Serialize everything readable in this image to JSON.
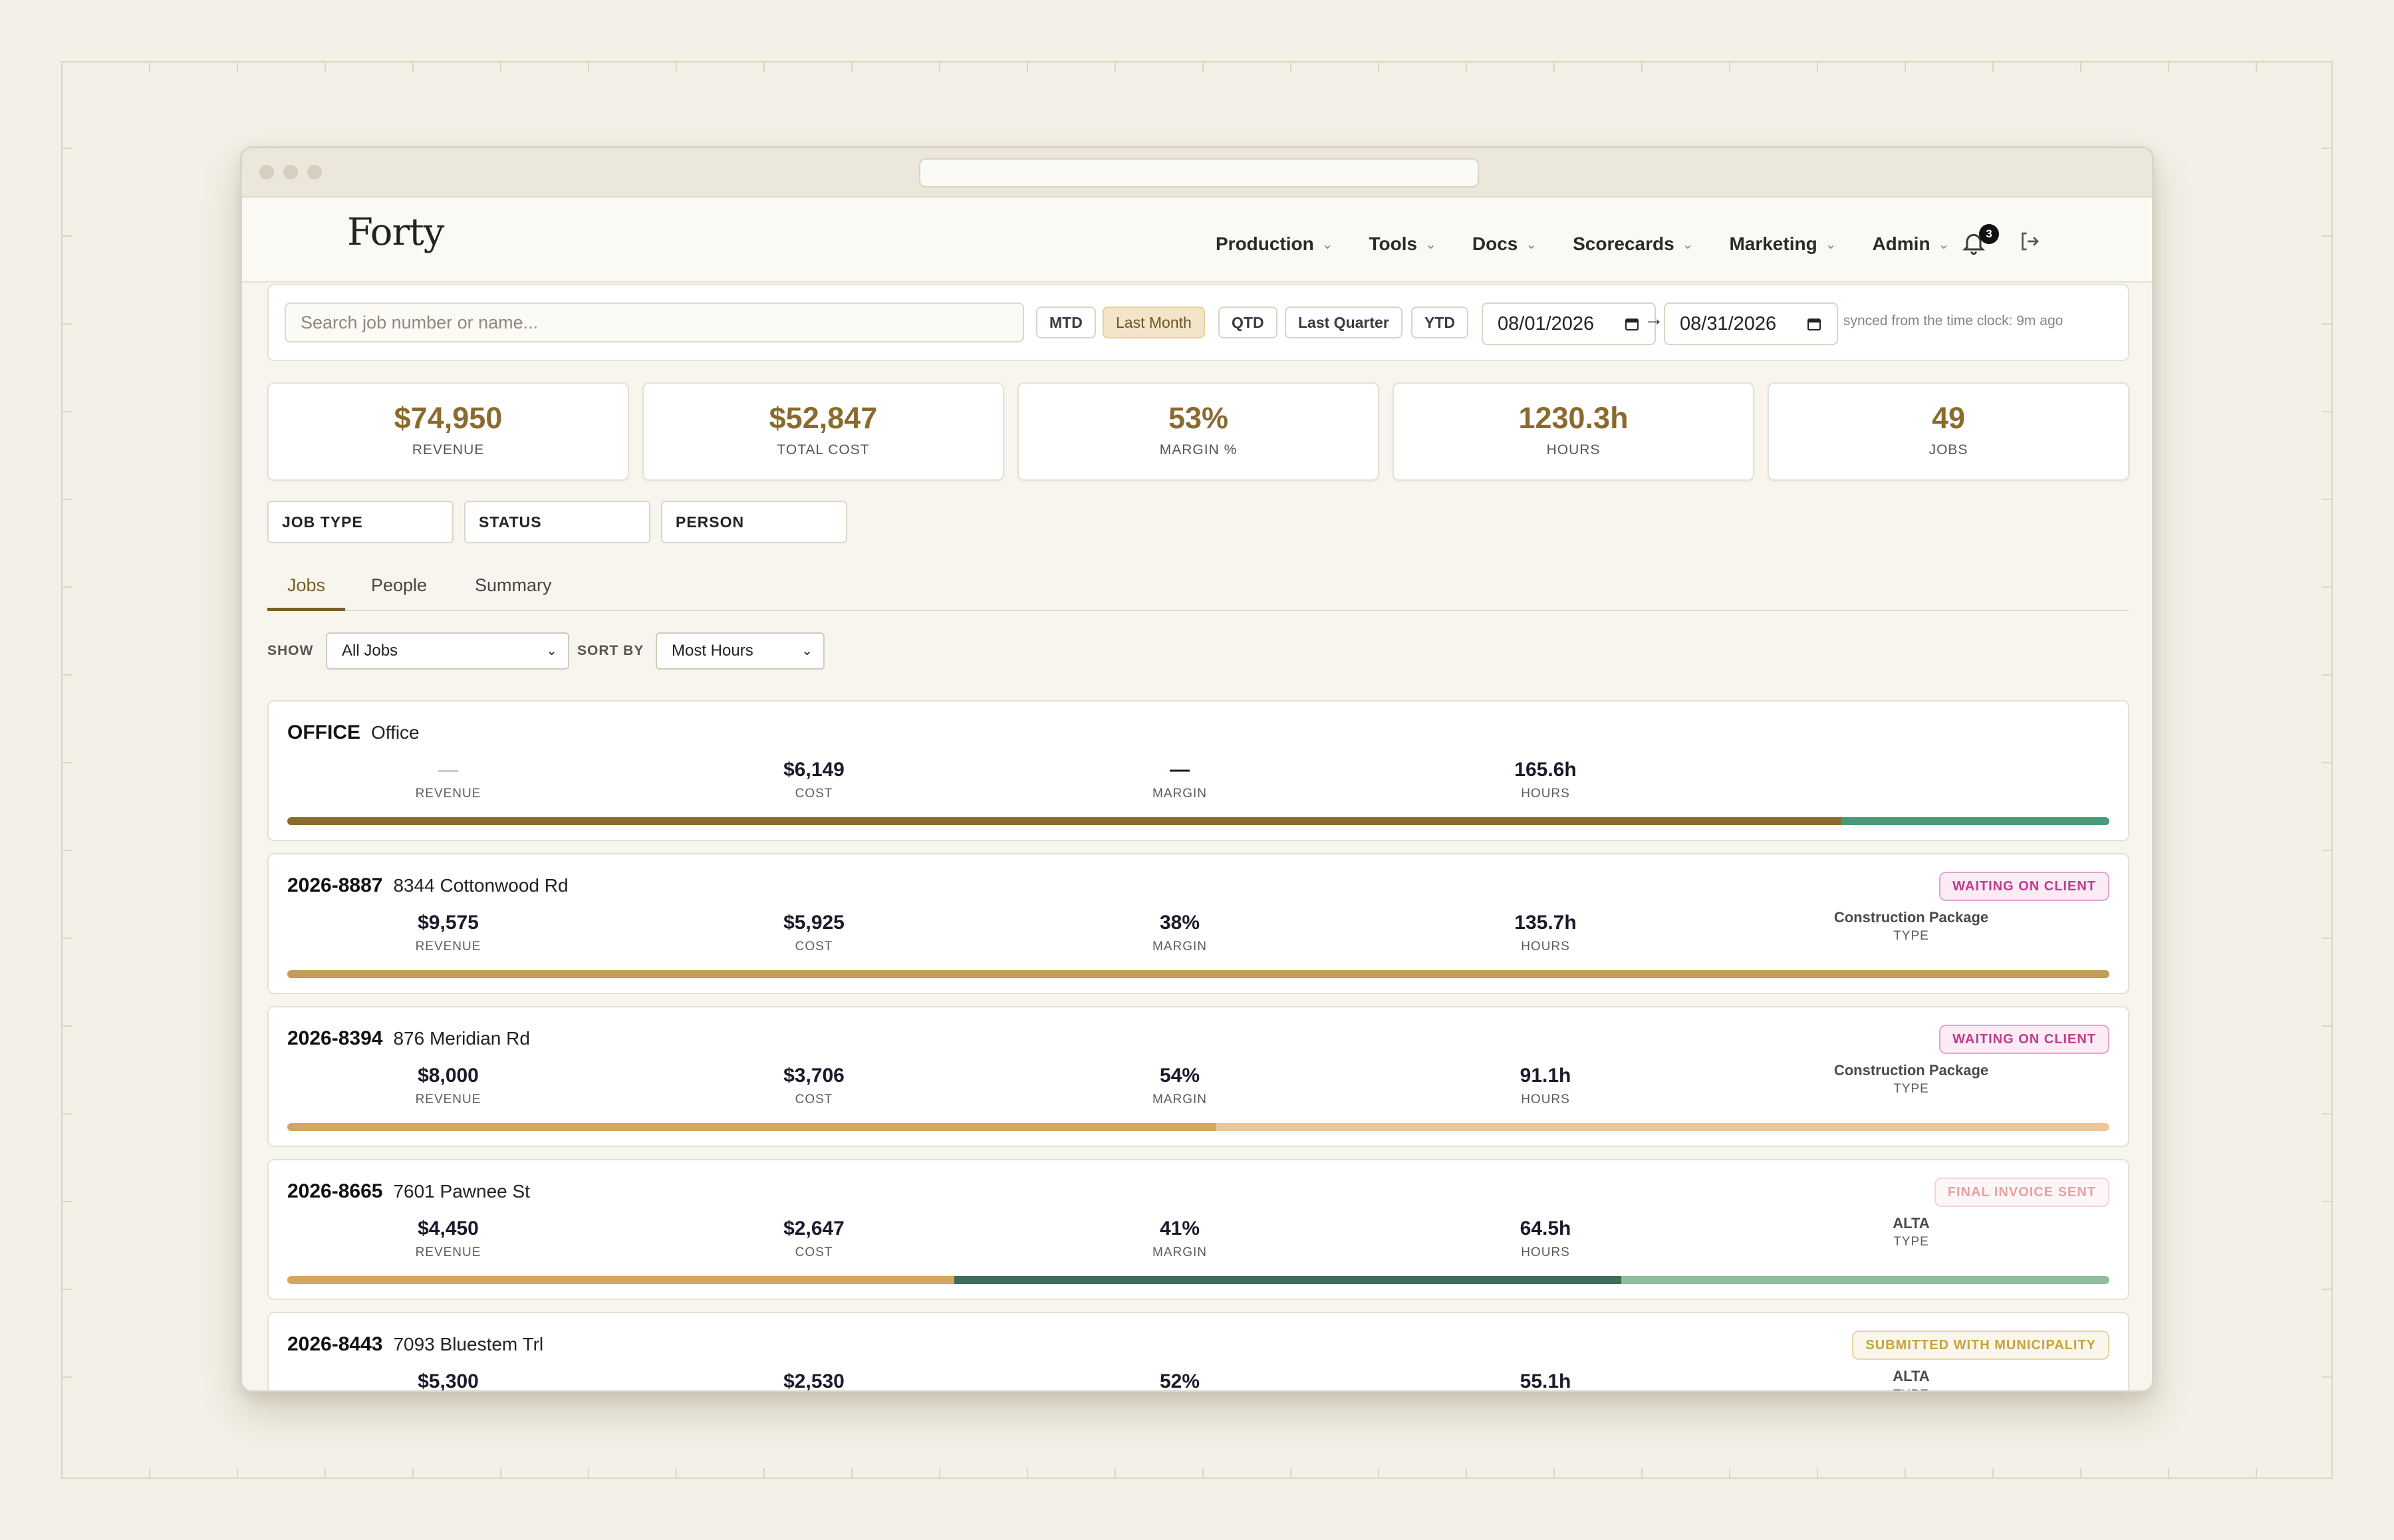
{
  "app": {
    "logo": "Forty",
    "nav": [
      "Production",
      "Tools",
      "Docs",
      "Scorecards",
      "Marketing",
      "Admin"
    ],
    "notifications_count": "3",
    "icons": [
      "bell-icon",
      "logout-icon",
      "calendar-icon",
      "chevron-down-icon"
    ]
  },
  "toolbar": {
    "search_placeholder": "Search job number or name...",
    "ranges": [
      "MTD",
      "Last Month",
      "QTD",
      "Last Quarter",
      "YTD"
    ],
    "active_range": "Last Month",
    "date_from": "08/01/2026",
    "arrow": "→",
    "date_to": "08/31/2026",
    "sync_text": "synced from the time clock: 9m ago"
  },
  "kpis": [
    {
      "value": "$74,950",
      "label": "REVENUE"
    },
    {
      "value": "$52,847",
      "label": "TOTAL COST"
    },
    {
      "value": "53%",
      "label": "MARGIN %"
    },
    {
      "value": "1230.3h",
      "label": "HOURS"
    },
    {
      "value": "49",
      "label": "JOBS"
    }
  ],
  "filters": [
    "JOB TYPE",
    "STATUS",
    "PERSON"
  ],
  "tabs": [
    "Jobs",
    "People",
    "Summary"
  ],
  "active_tab": "Jobs",
  "controls": {
    "show_label": "SHOW",
    "show_value": "All Jobs",
    "sort_label": "SORT BY",
    "sort_value": "Most Hours"
  },
  "metric_labels": {
    "revenue": "REVENUE",
    "cost": "COST",
    "margin": "MARGIN",
    "hours": "HOURS",
    "type": "TYPE"
  },
  "jobs": [
    {
      "number": "OFFICE",
      "name": "Office",
      "revenue": "—",
      "cost": "$6,149",
      "margin": "—",
      "hours": "165.6h",
      "type": "",
      "status": "",
      "status_color": "",
      "bar": [
        {
          "frac": 0.853,
          "color": "#8a6b2e"
        },
        {
          "frac": 0.147,
          "color": "#4a9878"
        }
      ]
    },
    {
      "number": "2026-8887",
      "name": "8344 Cottonwood Rd",
      "revenue": "$9,575",
      "cost": "$5,925",
      "margin": "38%",
      "hours": "135.7h",
      "type": "Construction Package",
      "status": "WAITING ON CLIENT",
      "status_color": "#c23a8e",
      "bar": [
        {
          "frac": 1.0,
          "color": "#c29d55"
        }
      ]
    },
    {
      "number": "2026-8394",
      "name": "876 Meridian Rd",
      "revenue": "$8,000",
      "cost": "$3,706",
      "margin": "54%",
      "hours": "91.1h",
      "type": "Construction Package",
      "status": "WAITING ON CLIENT",
      "status_color": "#c23a8e",
      "bar": [
        {
          "frac": 0.51,
          "color": "#d4a660"
        },
        {
          "frac": 0.49,
          "color": "#edc79a"
        }
      ]
    },
    {
      "number": "2026-8665",
      "name": "7601 Pawnee St",
      "revenue": "$4,450",
      "cost": "$2,647",
      "margin": "41%",
      "hours": "64.5h",
      "type": "ALTA",
      "status": "FINAL INVOICE SENT",
      "status_color": "#e8a0a4",
      "bar": [
        {
          "frac": 0.366,
          "color": "#d4a660"
        },
        {
          "frac": 0.366,
          "color": "#3d6e57"
        },
        {
          "frac": 0.268,
          "color": "#8ebd9c"
        }
      ]
    },
    {
      "number": "2026-8443",
      "name": "7093 Bluestem Trl",
      "revenue": "$5,300",
      "cost": "$2,530",
      "margin": "52%",
      "hours": "55.1h",
      "type": "ALTA",
      "status": "SUBMITTED WITH MUNICIPALITY",
      "status_color": "#c9a23a",
      "bar": []
    }
  ]
}
